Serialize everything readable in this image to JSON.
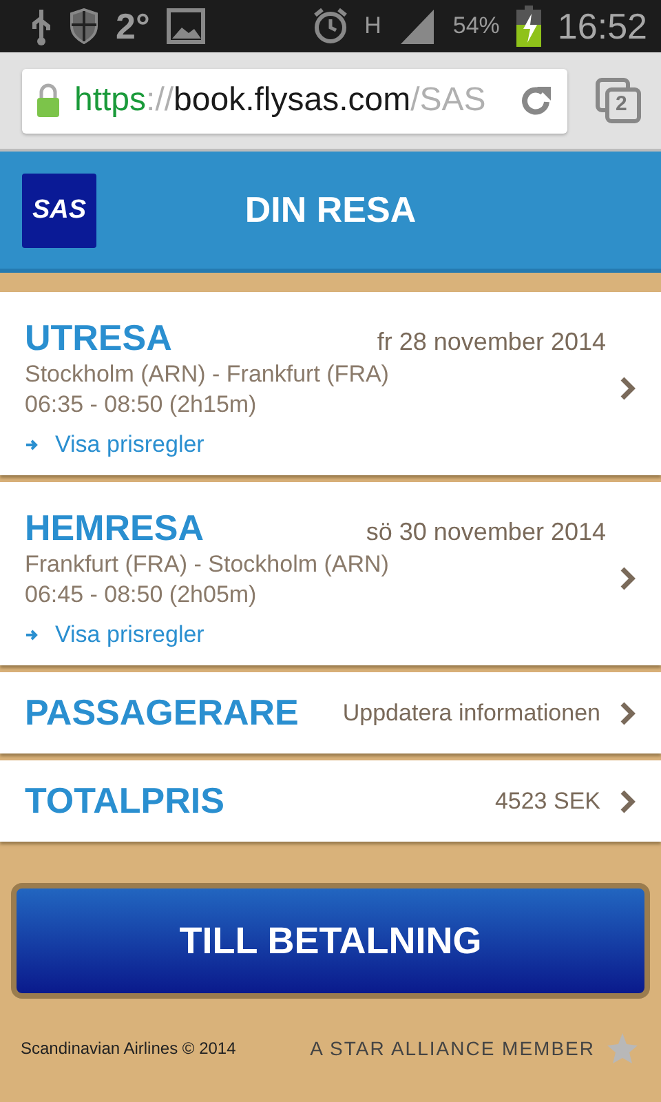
{
  "status_bar": {
    "temperature": "2°",
    "network": "H",
    "battery": "54%",
    "time": "16:52"
  },
  "browser": {
    "url_scheme": "https",
    "url_separator": "://",
    "url_host": "book.flysas.com",
    "url_path": "/SAS",
    "tab_count": "2"
  },
  "header": {
    "logo": "SAS",
    "title": "DIN RESA"
  },
  "trips": [
    {
      "label": "UTRESA",
      "date": "fr 28 november 2014",
      "route": "Stockholm (ARN) - Frankfurt (FRA)",
      "times": "06:35 - 08:50 (2h15m)",
      "link": "Visa prisregler"
    },
    {
      "label": "HEMRESA",
      "date": "sö 30 november 2014",
      "route": "Frankfurt (FRA) - Stockholm (ARN)",
      "times": "06:45 - 08:50 (2h05m)",
      "link": "Visa prisregler"
    }
  ],
  "summary": [
    {
      "label": "PASSAGERARE",
      "value": "Uppdatera informationen"
    },
    {
      "label": "TOTALPRIS",
      "value": "4523  SEK"
    }
  ],
  "pay_button": "TILL BETALNING",
  "footer": {
    "copyright": "Scandinavian Airlines © 2014",
    "alliance": "A STAR ALLIANCE MEMBER"
  }
}
